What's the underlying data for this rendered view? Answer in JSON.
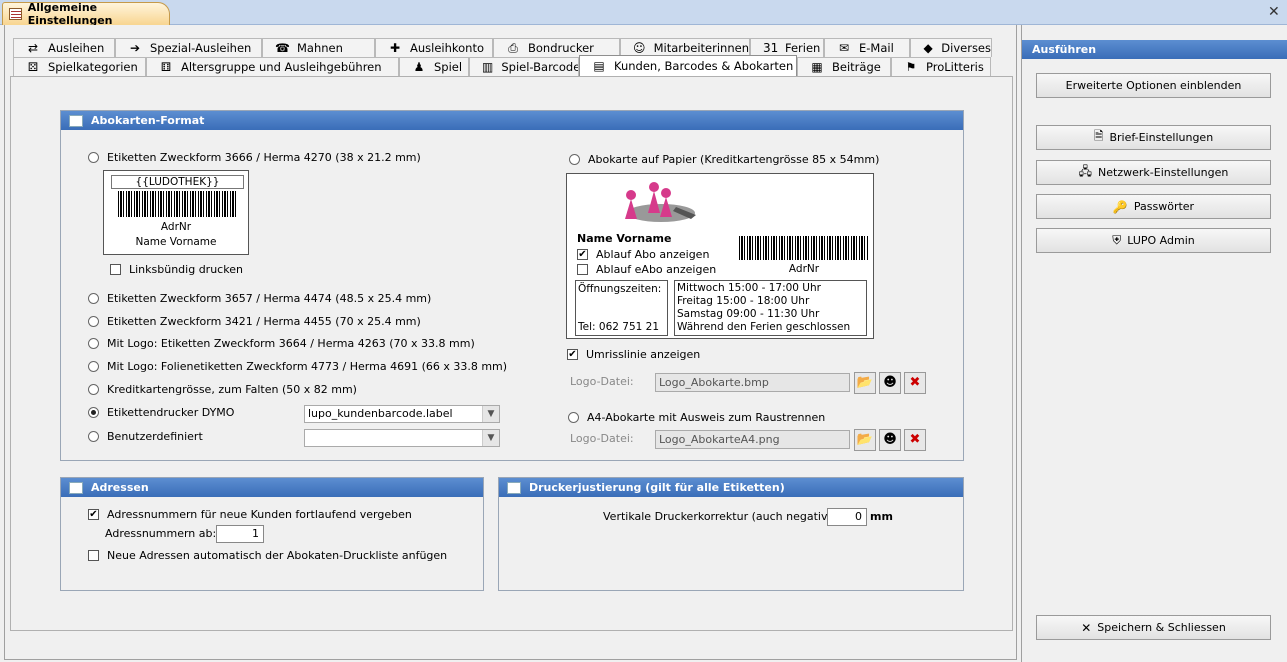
{
  "window": {
    "title": "Allgemeine Einstellungen",
    "close": "✕"
  },
  "tabs_row1": [
    {
      "label": "Ausleihen",
      "icon": "swap-arrows-icon",
      "glyph": "⇄"
    },
    {
      "label": "Spezial-Ausleihen",
      "icon": "arrow-right-icon",
      "glyph": "➔"
    },
    {
      "label": "Mahnen",
      "icon": "reminder-icon",
      "glyph": "☎"
    },
    {
      "label": "Ausleihkonto",
      "icon": "account-add-icon",
      "glyph": "✚"
    },
    {
      "label": "Bondrucker",
      "icon": "printer-icon",
      "glyph": "⎙"
    },
    {
      "label": "Mitarbeiterinnen",
      "icon": "staff-icon",
      "glyph": "☺"
    },
    {
      "label": "Ferien",
      "icon": "calendar-icon",
      "glyph": "31"
    },
    {
      "label": "E-Mail",
      "icon": "mail-icon",
      "glyph": "✉"
    },
    {
      "label": "Diverses",
      "icon": "misc-icon",
      "glyph": "◆"
    }
  ],
  "tabs_row2": [
    {
      "label": "Spielkategorien",
      "icon": "dice-icon",
      "glyph": "⚄"
    },
    {
      "label": "Altersgruppe und Ausleihgebühren",
      "icon": "dice-icon",
      "glyph": "⚅"
    },
    {
      "label": "Spiel",
      "icon": "game-icon",
      "glyph": "♟"
    },
    {
      "label": "Spiel-Barcode",
      "icon": "barcode-icon",
      "glyph": "▥"
    },
    {
      "label": "Kunden, Barcodes & Abokarten",
      "icon": "card-icon",
      "glyph": "▤"
    },
    {
      "label": "Beiträge",
      "icon": "money-icon",
      "glyph": "▦"
    },
    {
      "label": "ProLitteris",
      "icon": "flag-icon",
      "glyph": "⚑"
    }
  ],
  "abo": {
    "header": "Abokarten-Format",
    "opt1": "Etiketten Zweckform 3666 / Herma 4270 (38 x 21.2 mm)",
    "label_preview": {
      "title": "{{LUDOTHEK}}",
      "line1": "AdrNr",
      "line2": "Name Vorname"
    },
    "linksbuendig": "Linksbündig drucken",
    "opt2": "Etiketten Zweckform 3657 / Herma 4474 (48.5 x 25.4 mm)",
    "opt3": "Etiketten Zweckform 3421 / Herma 4455 (70 x 25.4 mm)",
    "opt4": "Mit Logo: Etiketten Zweckform 3664 / Herma 4263 (70 x 33.8 mm)",
    "opt5": "Mit Logo: Folienetiketten Zweckform 4773 / Herma 4691 (66 x 33.8 mm)",
    "opt6": "Kreditkartengrösse, zum Falten (50 x 82 mm)",
    "opt7": "Etikettendrucker DYMO",
    "opt7_value": "lupo_kundenbarcode.label",
    "opt8": "Benutzerdefiniert",
    "opt8_value": "",
    "opt9": "Abokarte auf Papier (Kreditkartengrösse 85 x 54mm)",
    "card": {
      "name": "Name Vorname",
      "ablauf_abo": "Ablauf Abo anzeigen",
      "ablauf_eabo": "Ablauf eAbo anzeigen",
      "adrnr": "AdrNr",
      "hours_label": "Öffnungszeiten:",
      "tel": "Tel: 062 751 21",
      "hours": [
        "Mittwoch 15:00 - 17:00 Uhr",
        "Freitag 15:00 - 18:00 Uhr",
        "Samstag 09:00 - 11:30 Uhr",
        "Während den Ferien geschlossen"
      ]
    },
    "umriss": "Umrisslinie anzeigen",
    "logo_label": "Logo-Datei:",
    "logo_file": "Logo_Abokarte.bmp",
    "opt10": "A4-Abokarte mit Ausweis zum Raustrennen",
    "logo_label2": "Logo-Datei:",
    "logo_file2": "Logo_AbokarteA4.png"
  },
  "adressen": {
    "header": "Adressen",
    "fortlaufend": "Adressnummern für neue Kunden fortlaufend vergeben",
    "ab_label": "Adressnummern ab:",
    "ab_value": "1",
    "auto": "Neue Adressen automatisch der Abokaten-Druckliste anfügen"
  },
  "justierung": {
    "header": "Druckerjustierung (gilt für alle Etiketten)",
    "label": "Vertikale Druckerkorrektur (auch negative):",
    "value": "0",
    "unit": "mm"
  },
  "side": {
    "header": "Ausführen",
    "erweitert": "Erweiterte Optionen einblenden",
    "brief": "Brief-Einstellungen",
    "netzwerk": "Netzwerk-Einstellungen",
    "passwoerter": "Passwörter",
    "admin": "LUPO Admin",
    "save": "Speichern & Schliessen"
  }
}
